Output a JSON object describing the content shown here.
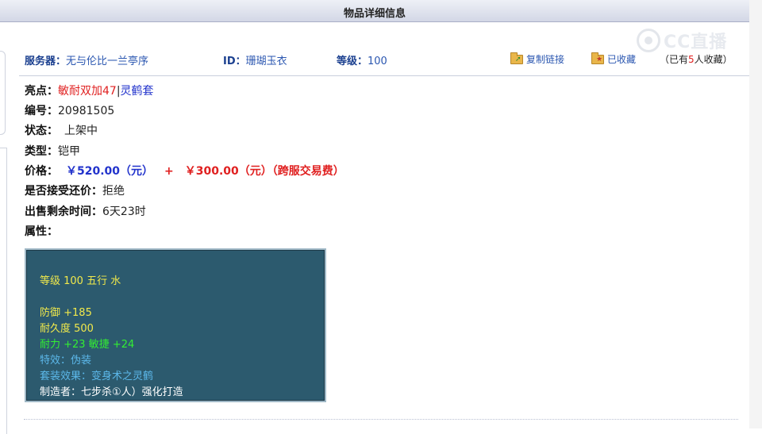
{
  "panel": {
    "title": "物品详细信息"
  },
  "header": {
    "server_label": "服务器：",
    "server_value": "无与伦比一兰亭序",
    "id_label": "ID：",
    "id_value": "珊瑚玉衣",
    "level_label": "等级：",
    "level_value": "100",
    "copy_link": "复制链接",
    "favorited": "已收藏",
    "fav_prefix": "（已有",
    "fav_count": "5",
    "fav_suffix": "人收藏）"
  },
  "details": {
    "highlight_label": "亮点：",
    "highlight_red": "敏耐双加47",
    "highlight_sep": "|",
    "highlight_blue": "灵鹤套",
    "serial_label": "编号：",
    "serial_value": "20981505",
    "status_label": "状态：",
    "status_value": "上架中",
    "type_label": "类型：",
    "type_value": "铠甲",
    "price_label": "价格：",
    "price_main": "￥520.00（元）",
    "price_plus": "+",
    "price_fee": "￥300.00（元）（跨服交易费）",
    "counter_label": "是否接受还价：",
    "counter_value": "拒绝",
    "remaining_label": "出售剩余时间：",
    "remaining_value": "6天23时",
    "attr_label": "属性："
  },
  "tooltip": {
    "line1": "等级 100 五行 水",
    "line2": "防御 +185",
    "line3": "耐久度 500",
    "line4": "耐力 +23 敏捷 +24",
    "line5": "特效：伪装",
    "line6": "套装效果：变身术之灵鹤",
    "line7": "制造者：七步杀①人）强化打造"
  },
  "watermark": {
    "text": "CC直播"
  },
  "colors": {
    "header_label": "#1a3f8f",
    "link": "#2a56b0",
    "price_blue": "#2233cc",
    "price_red": "#e02020",
    "tooltip_bg": "#2c5a6e",
    "tooltip_yellow": "#f1e94b",
    "tooltip_green": "#33ee33",
    "tooltip_cyan": "#5cb8ea"
  }
}
